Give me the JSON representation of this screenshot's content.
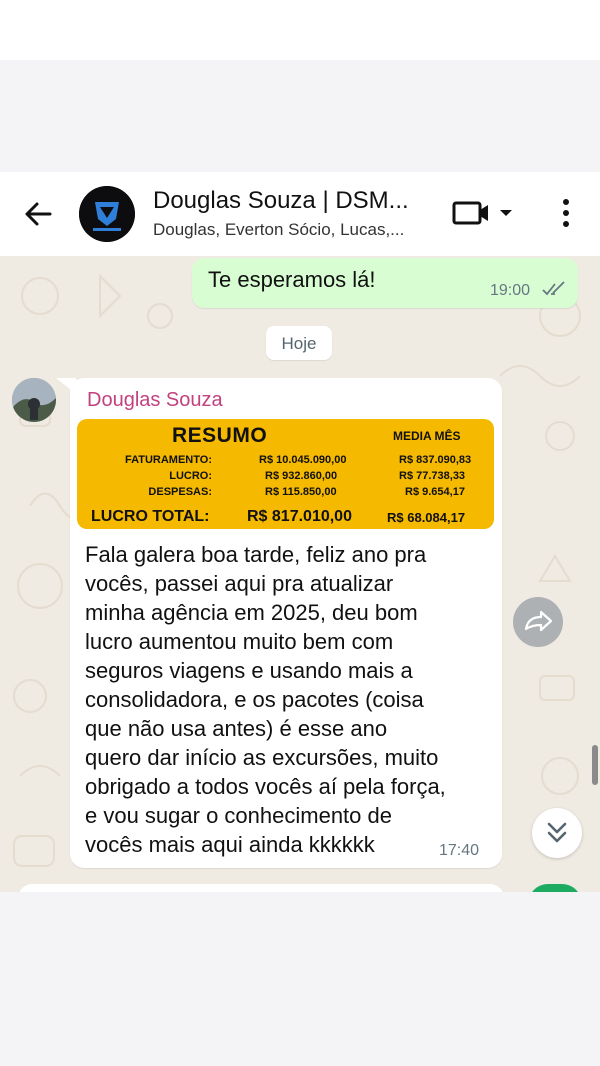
{
  "header": {
    "title": "Douglas Souza | DSM...",
    "subtitle": "Douglas, Everton Sócio, Lucas,...",
    "icons": [
      "back-arrow-icon",
      "group-avatar",
      "video-call-icon",
      "chevron-down-icon",
      "more-vert-icon"
    ]
  },
  "messages": {
    "outgoing": {
      "text": "Te esperamos lá!",
      "time": "19:00",
      "status": "read"
    },
    "date_chip": "Hoje",
    "incoming": {
      "sender": "Douglas Souza",
      "sender_color": "#c2417f",
      "image": {
        "title": "RESUMO",
        "media_header": "MEDIA MÊS",
        "rows": [
          {
            "label": "FATURAMENTO:",
            "total": "R$ 10.045.090,00",
            "media": "R$ 837.090,83"
          },
          {
            "label": "LUCRO:",
            "total": "R$ 932.860,00",
            "media": "R$ 77.738,33"
          },
          {
            "label": "DESPESAS:",
            "total": "R$ 115.850,00",
            "media": "R$ 9.654,17"
          }
        ],
        "total_label": "LUCRO TOTAL:",
        "total_value": "R$ 817.010,00",
        "total_media": "R$ 68.084,17",
        "background": "#f5b900"
      },
      "lines": [
        "Fala galera boa tarde, feliz ano pra",
        "vocês, passei aqui pra atualizar",
        "minha agência em 2025, deu bom",
        "lucro aumentou muito bem com",
        "seguros viagens e usando mais a",
        "consolidadora, e os pacotes (coisa",
        "que não usa antes) é esse ano",
        "quero dar início as excursões, muito",
        "obrigado a todos vocês aí pela força,",
        "e vou sugar o conhecimento de",
        "vocês mais aqui ainda kkkkkk"
      ],
      "time": "17:40"
    }
  },
  "colors": {
    "outgoing_bubble": "#d9fdd3",
    "chat_background": "#efeae2",
    "accent_green": "#1daa61"
  }
}
